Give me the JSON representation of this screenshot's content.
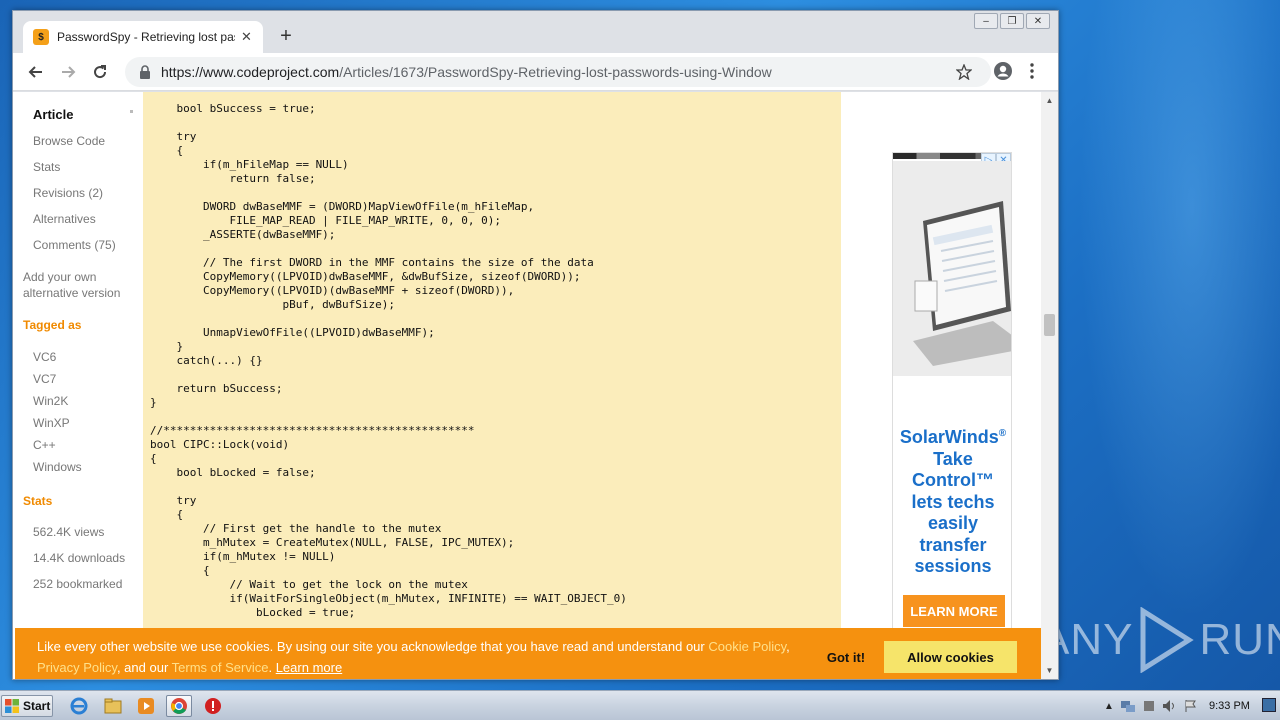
{
  "browser": {
    "tab_title": "PasswordSpy - Retrieving lost passwo",
    "favicon_text": "$",
    "url_host": "https://www.codeproject.com",
    "url_path": "/Articles/1673/PasswordSpy-Retrieving-lost-passwords-using-Window"
  },
  "sidebar": {
    "nav": [
      "Article",
      "Browse Code",
      "Stats",
      "Revisions (2)",
      "Alternatives",
      "Comments (75)"
    ],
    "add_alt": "Add your own alternative version",
    "tagged_heading": "Tagged as",
    "tags": [
      "VC6",
      "VC7",
      "Win2K",
      "WinXP",
      "C++",
      "Windows"
    ],
    "stats_heading": "Stats",
    "stats": [
      "562.4K views",
      "14.4K downloads",
      "252 bookmarked"
    ]
  },
  "code": {
    "lines": [
      "    bool bSuccess = true;",
      "",
      "    try",
      "    {",
      "        if(m_hFileMap == NULL)",
      "            return false;",
      "",
      "        DWORD dwBaseMMF = (DWORD)MapViewOfFile(m_hFileMap,",
      "            FILE_MAP_READ | FILE_MAP_WRITE, 0, 0, 0);",
      "        _ASSERTE(dwBaseMMF);",
      "",
      "        // The first DWORD in the MMF contains the size of the data",
      "        CopyMemory((LPVOID)dwBaseMMF, &dwBufSize, sizeof(DWORD));",
      "        CopyMemory((LPVOID)(dwBaseMMF + sizeof(DWORD)),",
      "                    pBuf, dwBufSize);",
      "",
      "        UnmapViewOfFile((LPVOID)dwBaseMMF);",
      "    }",
      "    catch(...) {}",
      "",
      "    return bSuccess;",
      "}",
      "",
      "//***********************************************",
      "bool CIPC::Lock(void)",
      "{",
      "    bool bLocked = false;",
      "",
      "    try",
      "    {",
      "        // First get the handle to the mutex",
      "        m_hMutex = CreateMutex(NULL, FALSE, IPC_MUTEX);",
      "        if(m_hMutex != NULL)",
      "        {",
      "            // Wait to get the lock on the mutex",
      "            if(WaitForSingleObject(m_hMutex, INFINITE) == WAIT_OBJECT_0)",
      "                bLocked = true;"
    ]
  },
  "ad": {
    "brand": "SolarWinds",
    "reg_mark": "®",
    "lines": [
      "Take",
      "Control™",
      "lets techs",
      "easily",
      "transfer",
      "sessions"
    ],
    "cta": "LEARN MORE"
  },
  "cookie": {
    "text1": "Like every other website we use cookies. By using our site you acknowledge that you have read and understand our ",
    "cookie_policy": "Cookie Policy",
    "sep1": ",",
    "privacy_policy": "Privacy Policy",
    "text2": ", and our ",
    "terms": "Terms of Service",
    "text3": ". ",
    "learn_more": "Learn more",
    "got_it": "Got it!",
    "allow": "Allow cookies"
  },
  "taskbar": {
    "start": "Start",
    "clock": "9:33 PM"
  },
  "watermark": {
    "left": "ANY",
    "right": "RUN"
  },
  "colors": {
    "code_bg": "#fbedbb",
    "accent_orange": "#f08a00",
    "cookie_bg": "#f5910f",
    "allow_btn": "#f6e46a",
    "ad_blue": "#1a6fc9"
  }
}
